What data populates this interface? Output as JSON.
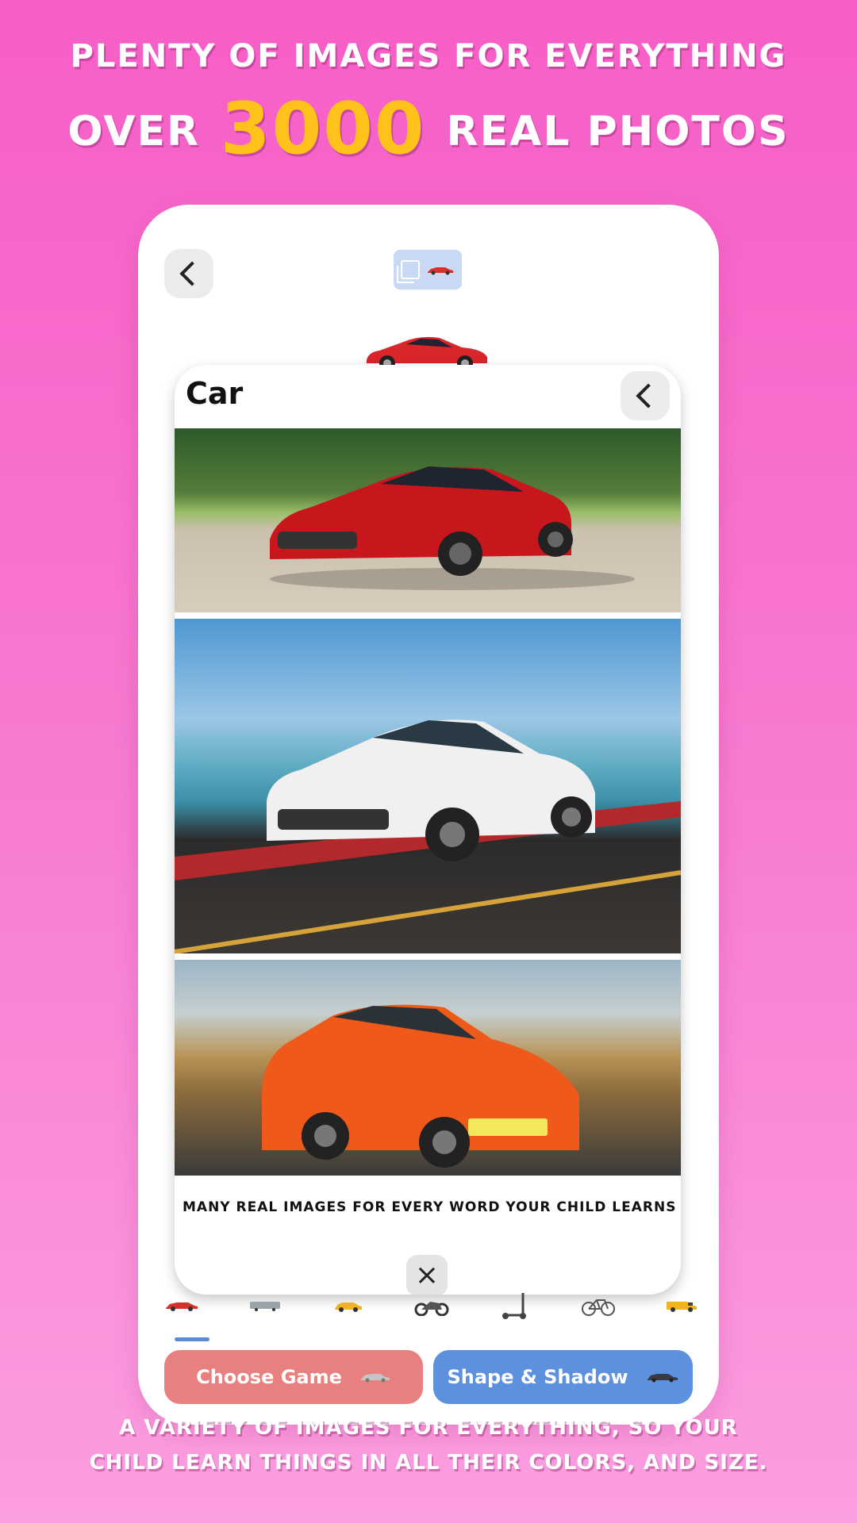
{
  "promo": {
    "headline1": "PLENTY OF IMAGES FOR EVERYTHING",
    "headline2_prefix": "OVER",
    "headline2_number": "3000",
    "headline2_suffix": "REAL PHOTOS",
    "caption_line1": "A VARIETY OF IMAGES FOR EVERYTHING, SO YOUR",
    "caption_line2": "CHILD LEARN THINGS IN ALL THEIR COLORS, AND SIZE."
  },
  "card": {
    "title": "Car",
    "caption": "MANY REAL IMAGES FOR EVERY WORD YOUR CHILD LEARNS"
  },
  "vehicles": [
    "car-icon",
    "bus-icon",
    "taxi-icon",
    "motorcycle-icon",
    "scooter-icon",
    "bicycle-icon",
    "van-icon"
  ],
  "buttons": {
    "choose_game": "Choose Game",
    "shape_shadow": "Shape & Shadow"
  },
  "colors": {
    "accent_yellow": "#ffc21a",
    "choose_game_bg": "#e88080",
    "shape_shadow_bg": "#5d90dd"
  }
}
